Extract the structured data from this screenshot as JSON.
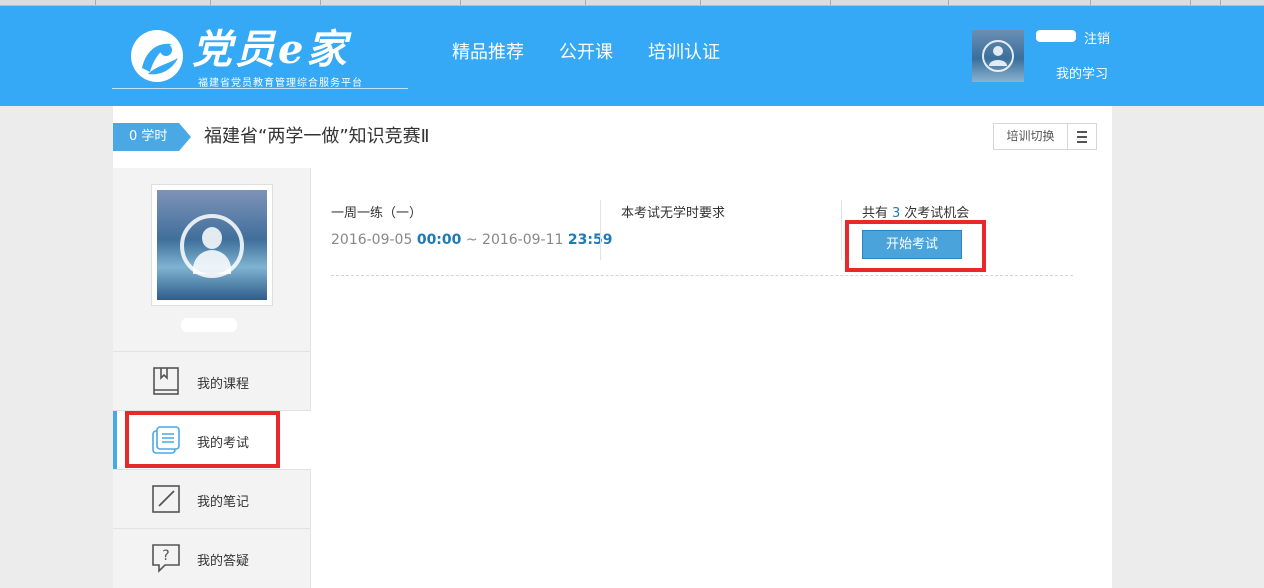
{
  "header": {
    "logo_title": "党员e家",
    "logo_subtitle": "福建省党员教育管理综合服务平台",
    "nav": [
      {
        "label": "精品推荐"
      },
      {
        "label": "公开课"
      },
      {
        "label": "培训认证"
      }
    ],
    "logout_label": "注销",
    "my_study_label": "我的学习"
  },
  "course": {
    "hours_tag": "0 学时",
    "title": "福建省“两学一做”知识竞赛Ⅱ",
    "switch_label": "培训切换"
  },
  "sidebar": {
    "menu": [
      {
        "label": "我的课程",
        "icon": "book-icon"
      },
      {
        "label": "我的考试",
        "icon": "exam-list-icon"
      },
      {
        "label": "我的笔记",
        "icon": "note-edit-icon"
      },
      {
        "label": "我的答疑",
        "icon": "question-icon"
      }
    ],
    "active_index": 1
  },
  "exam": {
    "name": "一周一练（一）",
    "start_date": "2016-09-05",
    "start_time": "00:00",
    "separator": "~",
    "end_date": "2016-09-11",
    "end_time": "23:59",
    "requirement": "本考试无学时要求",
    "chances_prefix": "共有",
    "chances_count": "3",
    "chances_suffix": "次考试机会",
    "start_button": "开始考试"
  },
  "colors": {
    "header_bg": "#35a8f6",
    "accent": "#4aa9e4",
    "highlight": "#e8292c",
    "time_text": "#1d7ab8"
  }
}
